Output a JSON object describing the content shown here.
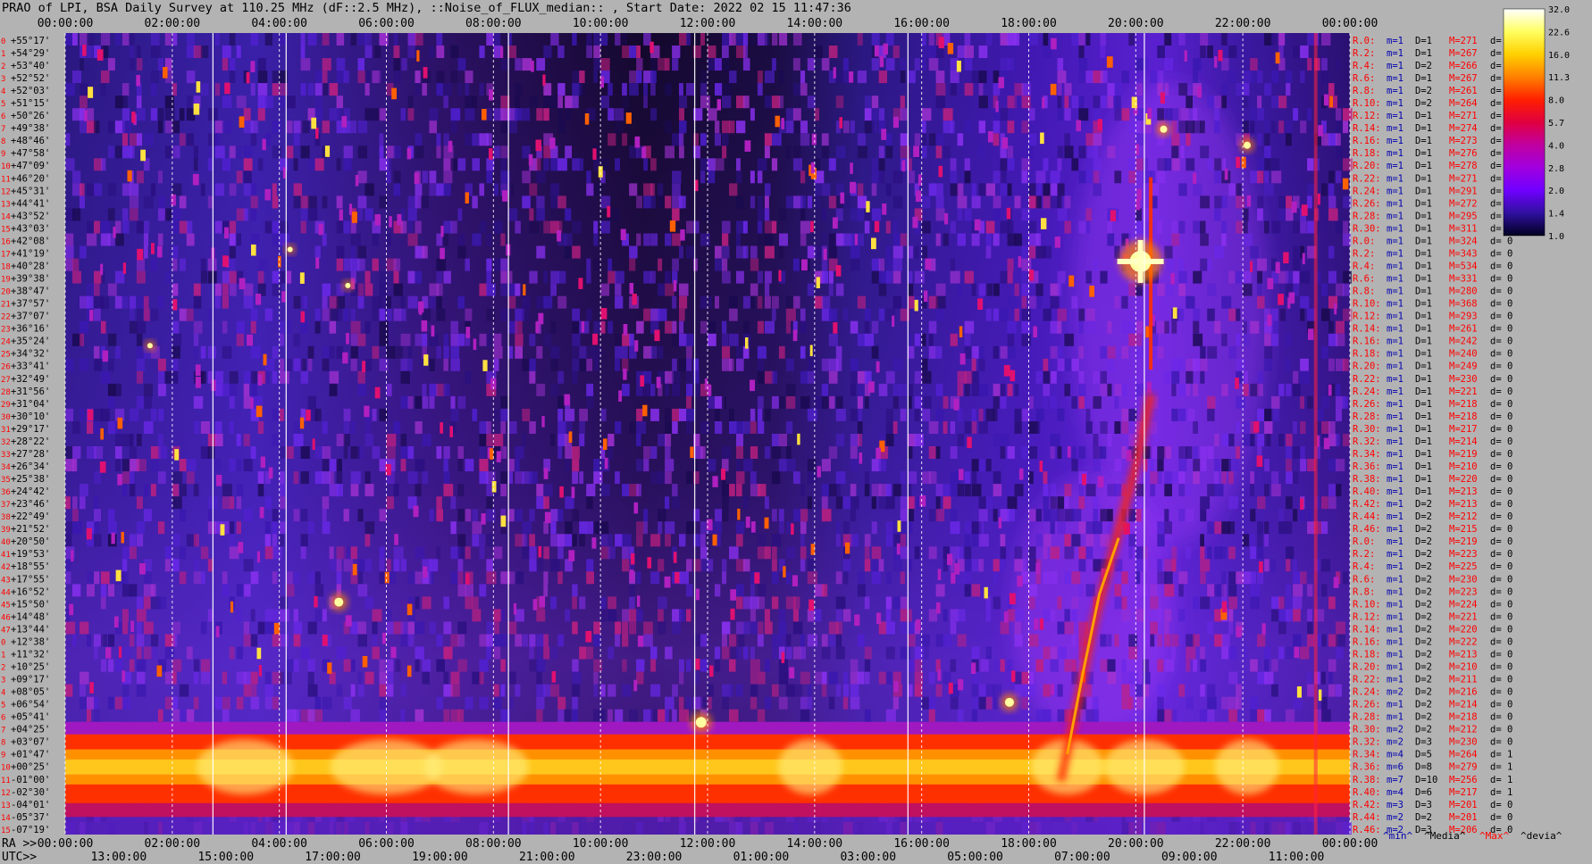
{
  "title": "PRAO of LPI, BSA Daily Survey at 110.25 MHz (dF::2.5 MHz), ::Noise_of_FLUX_median:: , Start Date: 2022 02 15 11:47:36",
  "chart_data": {
    "type": "heatmap",
    "top_axis_labels": [
      "00:00:00",
      "02:00:00",
      "04:00:00",
      "06:00:00",
      "08:00:00",
      "10:00:00",
      "12:00:00",
      "14:00:00",
      "16:00:00",
      "18:00:00",
      "20:00:00",
      "22:00:00",
      "00:00:00"
    ],
    "bottom_ra_prefix": "RA >>",
    "bottom_ra_labels": [
      "00:00:00",
      "02:00:00",
      "04:00:00",
      "06:00:00",
      "08:00:00",
      "10:00:00",
      "12:00:00",
      "14:00:00",
      "16:00:00",
      "18:00:00",
      "20:00:00",
      "22:00:00",
      "00:00:00"
    ],
    "bottom_utc_prefix": "UTC>>",
    "bottom_utc_labels": [
      "13:00:00",
      "15:00:00",
      "17:00:00",
      "19:00:00",
      "21:00:00",
      "23:00:00",
      "01:00:00",
      "03:00:00",
      "05:00:00",
      "07:00:00",
      "09:00:00",
      "11:00:00"
    ],
    "dec_labels": [
      "+55°17'",
      "+54°29'",
      "+53°40'",
      "+52°52'",
      "+52°03'",
      "+51°15'",
      "+50°26'",
      "+49°38'",
      "+48°46'",
      "+47°58'",
      "+47°09'",
      "+46°20'",
      "+45°31'",
      "+44°41'",
      "+43°52'",
      "+43°03'",
      "+42°08'",
      "+41°19'",
      "+40°28'",
      "+39°38'",
      "+38°47'",
      "+37°57'",
      "+37°07'",
      "+36°16'",
      "+35°24'",
      "+34°32'",
      "+33°41'",
      "+32°49'",
      "+31°56'",
      "+31°04'",
      "+30°10'",
      "+29°17'",
      "+28°22'",
      "+27°28'",
      "+26°34'",
      "+25°38'",
      "+24°42'",
      "+23°46'",
      "+22°49'",
      "+21°52'",
      "+20°50'",
      "+19°53'",
      "+18°55'",
      "+17°55'",
      "+16°52'",
      "+15°50'",
      "+14°48'",
      "+13°44'",
      "+12°38'",
      "+11°32'",
      "+10°25'",
      "+09°17'",
      "+08°05'",
      "+06°54'",
      "+05°41'",
      "+04°25'",
      "+03°07'",
      "+01°47'",
      "+00°25'",
      "-01°00'",
      "-02°30'",
      "-04°01'",
      "-05°37'",
      "-07°19'"
    ],
    "colorbar": {
      "ticks": [
        "32.0",
        "22.6",
        "16.0",
        "11.3",
        "8.0",
        "5.7",
        "4.0",
        "2.8",
        "2.0",
        "1.4",
        "1.0"
      ],
      "colors": [
        "#ffffff",
        "#ffff60",
        "#ffd000",
        "#ff8000",
        "#ff2000",
        "#e00040",
        "#c000a0",
        "#a000e0",
        "#7000ff",
        "#3010a0",
        "#000020"
      ]
    },
    "receiver_stats": [
      {
        "r": "R.0:",
        "m": "m=1",
        "D": "D=1",
        "M": "M=271",
        "d": "d= 0"
      },
      {
        "r": "R.2:",
        "m": "m=1",
        "D": "D=1",
        "M": "M=267",
        "d": "d= 0"
      },
      {
        "r": "R.4:",
        "m": "m=1",
        "D": "D=2",
        "M": "M=266",
        "d": "d= 0"
      },
      {
        "r": "R.6:",
        "m": "m=1",
        "D": "D=1",
        "M": "M=267",
        "d": "d= 0"
      },
      {
        "r": "R.8:",
        "m": "m=1",
        "D": "D=2",
        "M": "M=261",
        "d": "d= 0"
      },
      {
        "r": "R.10:",
        "m": "m=1",
        "D": "D=2",
        "M": "M=264",
        "d": "d= 0"
      },
      {
        "r": "R.12:",
        "m": "m=1",
        "D": "D=1",
        "M": "M=271",
        "d": "d="
      },
      {
        "r": "R.14:",
        "m": "m=1",
        "D": "D=1",
        "M": "M=274",
        "d": "d="
      },
      {
        "r": "R.16:",
        "m": "m=1",
        "D": "D=1",
        "M": "M=273",
        "d": "d="
      },
      {
        "r": "R.18:",
        "m": "m=1",
        "D": "D=1",
        "M": "M=276",
        "d": "d="
      },
      {
        "r": "R.20:",
        "m": "m=1",
        "D": "D=1",
        "M": "M=278",
        "d": "d="
      },
      {
        "r": "R.22:",
        "m": "m=1",
        "D": "D=1",
        "M": "M=271",
        "d": "d="
      },
      {
        "r": "R.24:",
        "m": "m=1",
        "D": "D=1",
        "M": "M=291",
        "d": "d="
      },
      {
        "r": "R.26:",
        "m": "m=1",
        "D": "D=1",
        "M": "M=272",
        "d": "d="
      },
      {
        "r": "R.28:",
        "m": "m=1",
        "D": "D=1",
        "M": "M=295",
        "d": "d="
      },
      {
        "r": "R.30:",
        "m": "m=1",
        "D": "D=1",
        "M": "M=311",
        "d": "d="
      },
      {
        "r": "R.0:",
        "m": "m=1",
        "D": "D=1",
        "M": "M=324",
        "d": "d= 0"
      },
      {
        "r": "R.2:",
        "m": "m=1",
        "D": "D=1",
        "M": "M=343",
        "d": "d= 0"
      },
      {
        "r": "R.4:",
        "m": "m=1",
        "D": "D=1",
        "M": "M=534",
        "d": "d= 0"
      },
      {
        "r": "R.6:",
        "m": "m=1",
        "D": "D=1",
        "M": "M=331",
        "d": "d= 0"
      },
      {
        "r": "R.8:",
        "m": "m=1",
        "D": "D=1",
        "M": "M=280",
        "d": "d= 0"
      },
      {
        "r": "R.10:",
        "m": "m=1",
        "D": "D=1",
        "M": "M=368",
        "d": "d= 0"
      },
      {
        "r": "R.12:",
        "m": "m=1",
        "D": "D=1",
        "M": "M=293",
        "d": "d= 0"
      },
      {
        "r": "R.14:",
        "m": "m=1",
        "D": "D=1",
        "M": "M=261",
        "d": "d= 0"
      },
      {
        "r": "R.16:",
        "m": "m=1",
        "D": "D=1",
        "M": "M=242",
        "d": "d= 0"
      },
      {
        "r": "R.18:",
        "m": "m=1",
        "D": "D=1",
        "M": "M=240",
        "d": "d= 0"
      },
      {
        "r": "R.20:",
        "m": "m=1",
        "D": "D=1",
        "M": "M=249",
        "d": "d= 0"
      },
      {
        "r": "R.22:",
        "m": "m=1",
        "D": "D=1",
        "M": "M=230",
        "d": "d= 0"
      },
      {
        "r": "R.24:",
        "m": "m=1",
        "D": "D=1",
        "M": "M=221",
        "d": "d= 0"
      },
      {
        "r": "R.26:",
        "m": "m=1",
        "D": "D=1",
        "M": "M=218",
        "d": "d= 0"
      },
      {
        "r": "R.28:",
        "m": "m=1",
        "D": "D=1",
        "M": "M=218",
        "d": "d= 0"
      },
      {
        "r": "R.30:",
        "m": "m=1",
        "D": "D=1",
        "M": "M=217",
        "d": "d= 0"
      },
      {
        "r": "R.32:",
        "m": "m=1",
        "D": "D=1",
        "M": "M=214",
        "d": "d= 0"
      },
      {
        "r": "R.34:",
        "m": "m=1",
        "D": "D=1",
        "M": "M=219",
        "d": "d= 0"
      },
      {
        "r": "R.36:",
        "m": "m=1",
        "D": "D=1",
        "M": "M=210",
        "d": "d= 0"
      },
      {
        "r": "R.38:",
        "m": "m=1",
        "D": "D=1",
        "M": "M=220",
        "d": "d= 0"
      },
      {
        "r": "R.40:",
        "m": "m=1",
        "D": "D=1",
        "M": "M=213",
        "d": "d= 0"
      },
      {
        "r": "R.42:",
        "m": "m=1",
        "D": "D=2",
        "M": "M=213",
        "d": "d= 0"
      },
      {
        "r": "R.44:",
        "m": "m=1",
        "D": "D=2",
        "M": "M=212",
        "d": "d= 0"
      },
      {
        "r": "R.46:",
        "m": "m=1",
        "D": "D=2",
        "M": "M=215",
        "d": "d= 0"
      },
      {
        "r": "R.0:",
        "m": "m=1",
        "D": "D=2",
        "M": "M=219",
        "d": "d= 0"
      },
      {
        "r": "R.2:",
        "m": "m=1",
        "D": "D=2",
        "M": "M=223",
        "d": "d= 0"
      },
      {
        "r": "R.4:",
        "m": "m=1",
        "D": "D=2",
        "M": "M=225",
        "d": "d= 0"
      },
      {
        "r": "R.6:",
        "m": "m=1",
        "D": "D=2",
        "M": "M=230",
        "d": "d= 0"
      },
      {
        "r": "R.8:",
        "m": "m=1",
        "D": "D=2",
        "M": "M=223",
        "d": "d= 0"
      },
      {
        "r": "R.10:",
        "m": "m=1",
        "D": "D=2",
        "M": "M=224",
        "d": "d= 0"
      },
      {
        "r": "R.12:",
        "m": "m=1",
        "D": "D=2",
        "M": "M=221",
        "d": "d= 0"
      },
      {
        "r": "R.14:",
        "m": "m=1",
        "D": "D=2",
        "M": "M=220",
        "d": "d= 0"
      },
      {
        "r": "R.16:",
        "m": "m=1",
        "D": "D=2",
        "M": "M=222",
        "d": "d= 0"
      },
      {
        "r": "R.18:",
        "m": "m=1",
        "D": "D=2",
        "M": "M=213",
        "d": "d= 0"
      },
      {
        "r": "R.20:",
        "m": "m=1",
        "D": "D=2",
        "M": "M=210",
        "d": "d= 0"
      },
      {
        "r": "R.22:",
        "m": "m=1",
        "D": "D=2",
        "M": "M=211",
        "d": "d= 0"
      },
      {
        "r": "R.24:",
        "m": "m=2",
        "D": "D=2",
        "M": "M=216",
        "d": "d= 0"
      },
      {
        "r": "R.26:",
        "m": "m=1",
        "D": "D=2",
        "M": "M=214",
        "d": "d= 0"
      },
      {
        "r": "R.28:",
        "m": "m=1",
        "D": "D=2",
        "M": "M=218",
        "d": "d= 0"
      },
      {
        "r": "R.30:",
        "m": "m=2",
        "D": "D=2",
        "M": "M=212",
        "d": "d= 0"
      },
      {
        "r": "R.32:",
        "m": "m=2",
        "D": "D=3",
        "M": "M=230",
        "d": "d= 0"
      },
      {
        "r": "R.34:",
        "m": "m=4",
        "D": "D=5",
        "M": "M=264",
        "d": "d= 1"
      },
      {
        "r": "R.36:",
        "m": "m=6",
        "D": "D=8",
        "M": "M=279",
        "d": "d= 1"
      },
      {
        "r": "R.38:",
        "m": "m=7",
        "D": "D=10",
        "M": "M=256",
        "d": "d= 1"
      },
      {
        "r": "R.40:",
        "m": "m=4",
        "D": "D=6",
        "M": "M=217",
        "d": "d= 1"
      },
      {
        "r": "R.42:",
        "m": "m=3",
        "D": "D=3",
        "M": "M=201",
        "d": "d= 0"
      },
      {
        "r": "R.44:",
        "m": "m=2",
        "D": "D=2",
        "M": "M=201",
        "d": "d= 0"
      },
      {
        "r": "R.46:",
        "m": "m=2",
        "D": "D=3",
        "M": "M=206",
        "d": "d= 0"
      }
    ],
    "stats_legend": [
      "^min^",
      "^Media^",
      "^Max^",
      "^devia^"
    ],
    "colors": {
      "background": "#b3b3b3",
      "dec_text": "#000000",
      "row_index": "#ff0000",
      "stat_red": "#ff0000",
      "stat_blue": "#0000b0",
      "legend_blue": "#0000b0",
      "legend_red": "#ff0000"
    }
  }
}
